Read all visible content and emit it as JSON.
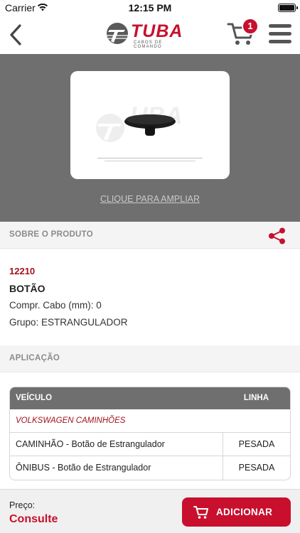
{
  "status_bar": {
    "carrier": "Carrier",
    "time": "12:15 PM",
    "wifi_icon": "wifi-icon",
    "battery_icon": "battery-icon"
  },
  "nav": {
    "back_icon": "chevron-left-icon",
    "logo_text": "TUBA",
    "logo_subtitle": "CABOS DE COMANDO",
    "cart_icon": "cart-icon",
    "cart_count": "1",
    "menu_icon": "hamburger-menu-icon"
  },
  "product_image": {
    "enlarge_label": "CLIQUE PARA AMPLIAR"
  },
  "about_section": {
    "title": "SOBRE O PRODUTO",
    "share_icon": "share-icon"
  },
  "product": {
    "code": "12210",
    "name": "BOTÃO",
    "cable_length": "Compr. Cabo (mm): 0",
    "group": "Grupo: ESTRANGULADOR"
  },
  "application_section": {
    "title": "APLICAÇÃO"
  },
  "application_table": {
    "headers": {
      "vehicle": "VEÍCULO",
      "line": "LINHA"
    },
    "brand": "VOLKSWAGEN CAMINHÕES",
    "rows": [
      {
        "vehicle": "CAMINHÃO - Botão de Estrangulador",
        "line": "PESADA"
      },
      {
        "vehicle": "ÔNIBUS - Botão de Estrangulador",
        "line": "PESADA"
      }
    ]
  },
  "footer": {
    "price_label": "Preço:",
    "price_value": "Consulte",
    "add_button_label": "ADICIONAR",
    "add_button_icon": "cart-icon"
  },
  "colors": {
    "brand_red": "#c8102e",
    "code_red": "#a3121d",
    "gray_band": "#6f6f6f"
  }
}
